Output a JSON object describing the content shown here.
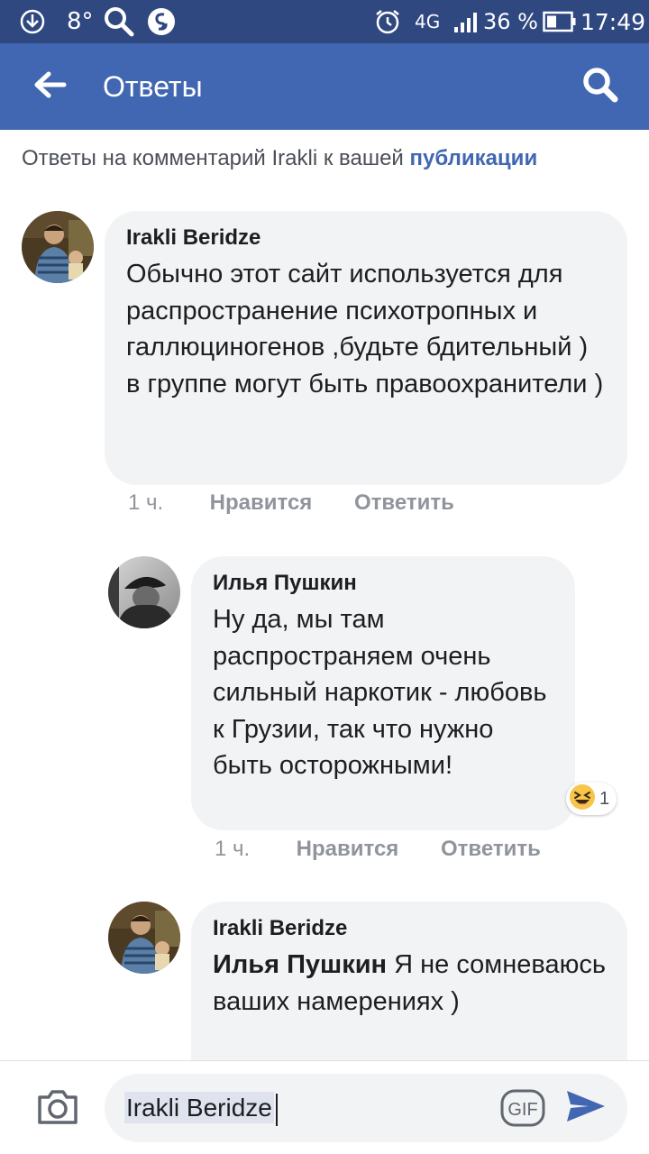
{
  "status_bar": {
    "temperature": "8°",
    "network": "4G",
    "battery": "36 %",
    "time": "17:49",
    "bg_color": "#2f4880"
  },
  "app_bar": {
    "title": "Ответы",
    "bg_color": "#4267b2",
    "back_icon": "arrow-left-icon",
    "search_icon": "search-icon"
  },
  "context": {
    "text": "Ответы на комментарий Irakli к вашей ",
    "link": "публикации",
    "link_color": "#4267b2"
  },
  "comments": [
    {
      "author": "Irakli Beridze",
      "text": "Обычно этот сайт используется для распространение психотропных и галлюциногенов ,будьте бдительный ) в группе могут быть правоохранители )",
      "time": "1 ч.",
      "like": "Нравится",
      "reply": "Ответить"
    },
    {
      "author": "Илья Пушкин",
      "text": "Ну да, мы там распространяем очень сильный наркотик - любовь к Грузии, так что нужно быть осторожными!",
      "time": "1 ч.",
      "like": "Нравится",
      "reply": "Ответить",
      "reaction": {
        "icon": "haha-emoji-icon",
        "count": "1"
      }
    },
    {
      "author": "Irakli Beridze",
      "mention": "Илья Пушкин",
      "text": " Я не сомневаюсь ваших намерениях )"
    }
  ],
  "composer": {
    "value": "Irakli Beridze",
    "camera_icon": "camera-icon",
    "gif_label": "GIF",
    "send_icon": "send-icon",
    "send_color": "#4267b2"
  }
}
